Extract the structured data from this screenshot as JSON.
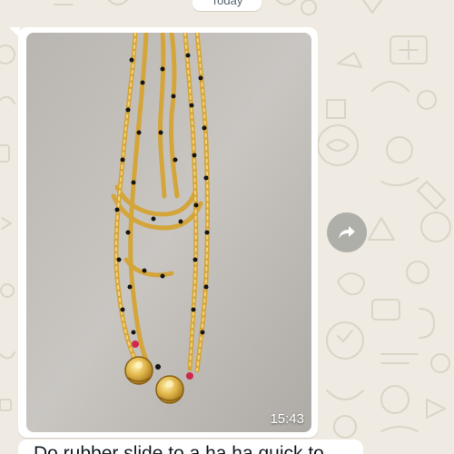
{
  "chat": {
    "date_label": "Today",
    "message": {
      "image_subject": "gold mangalsutra necklace with black beads and two round gold pendants",
      "time": "15:43",
      "caption_partial": "Do rubber slide to a ha ha quick to"
    },
    "forward_icon": "forward-arrow-icon"
  },
  "colors": {
    "wallpaper": "#efeae2",
    "doodle": "#d9d2c5",
    "bubble": "#ffffff",
    "forward_bg": "#0b141a"
  }
}
